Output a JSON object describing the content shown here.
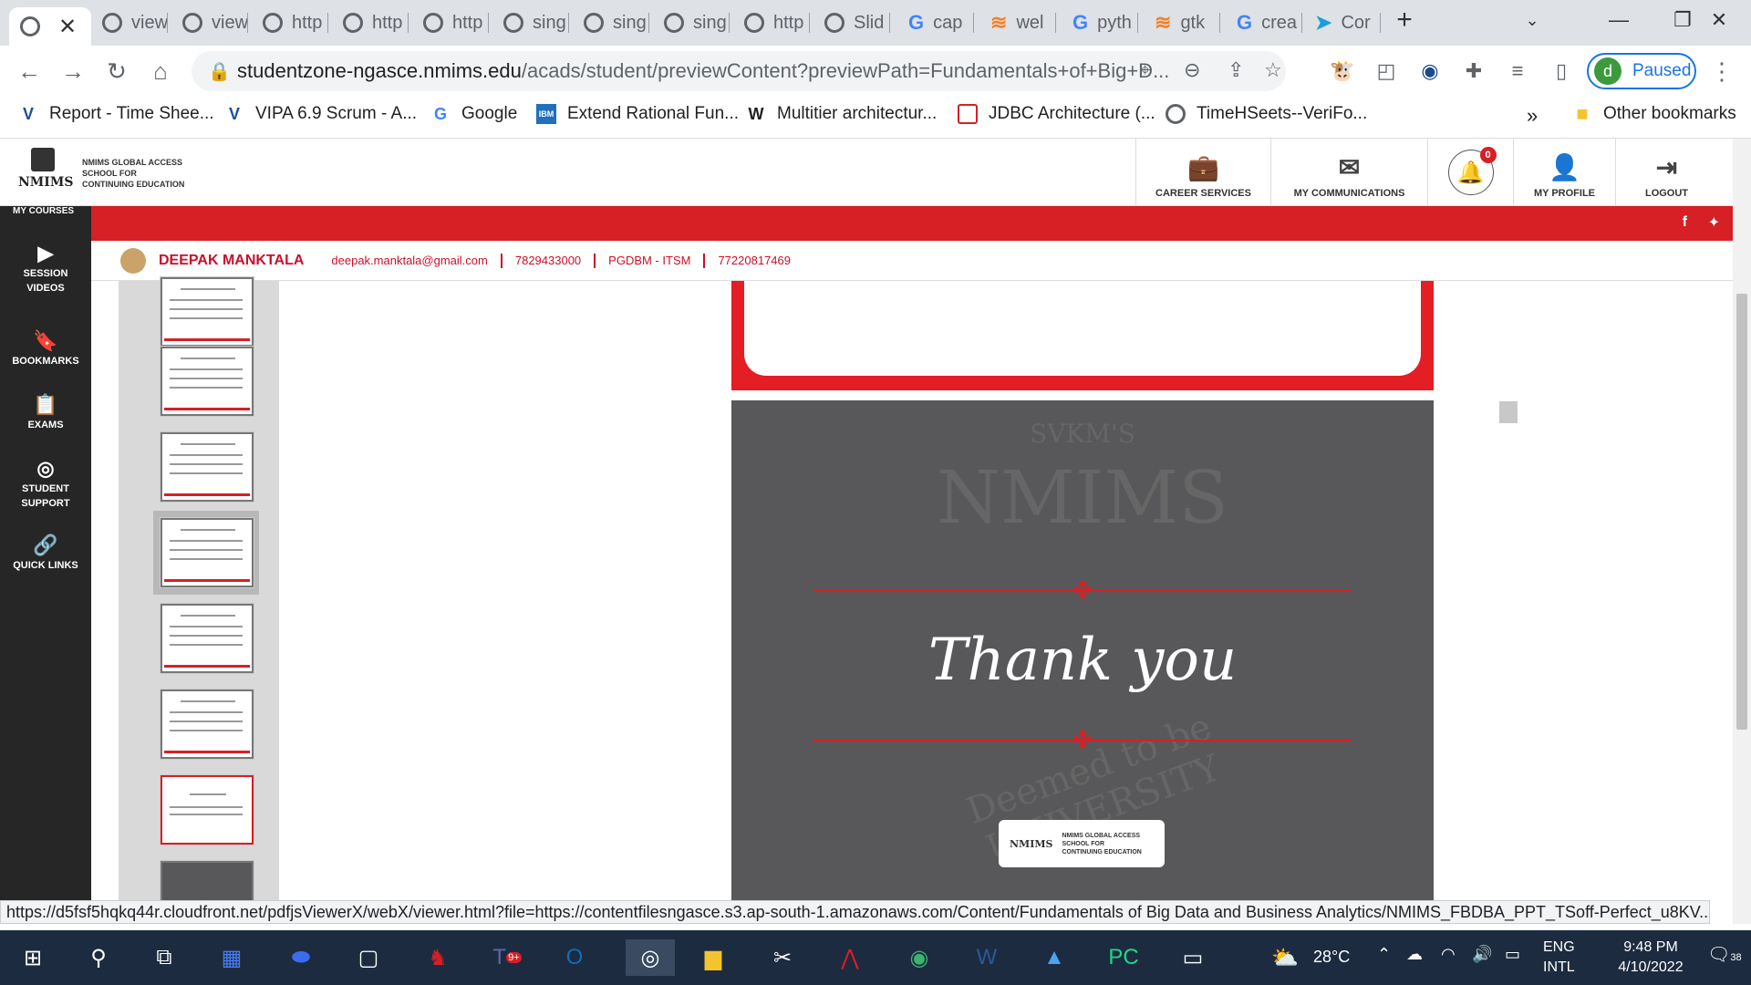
{
  "browser": {
    "tabs": [
      {
        "label": "",
        "icon": "globe-icon"
      },
      {
        "label": "view",
        "icon": "globe-icon"
      },
      {
        "label": "view",
        "icon": "globe-icon"
      },
      {
        "label": "http",
        "icon": "globe-icon"
      },
      {
        "label": "http",
        "icon": "globe-icon"
      },
      {
        "label": "http",
        "icon": "globe-icon"
      },
      {
        "label": "sing",
        "icon": "globe-icon"
      },
      {
        "label": "sing",
        "icon": "globe-icon"
      },
      {
        "label": "sing",
        "icon": "globe-icon"
      },
      {
        "label": "http",
        "icon": "globe-icon"
      },
      {
        "label": "Slid",
        "icon": "globe-icon"
      },
      {
        "label": "cap",
        "icon": "google-icon"
      },
      {
        "label": "wel",
        "icon": "stackoverflow-icon"
      },
      {
        "label": "pyth",
        "icon": "google-icon"
      },
      {
        "label": "gtk",
        "icon": "stackoverflow-icon"
      },
      {
        "label": "crea",
        "icon": "google-icon"
      },
      {
        "label": "Cor",
        "icon": "fish-icon"
      }
    ],
    "url_host": "studentzone-ngasce.nmims.edu",
    "url_path": "/acads/student/previewContent?previewPath=Fundamentals+of+Big+D...",
    "profile_initial": "d",
    "profile_label": "Paused",
    "bookmarks": [
      {
        "label": "Report - Time Shee..."
      },
      {
        "label": "VIPA 6.9 Scrum - A..."
      },
      {
        "label": "Google"
      },
      {
        "label": "Extend Rational Fun..."
      },
      {
        "label": "Multitier architectur..."
      },
      {
        "label": "JDBC Architecture (..."
      },
      {
        "label": "TimeHSeets--VeriFo..."
      }
    ],
    "overflow": "»",
    "other_bookmarks": "Other bookmarks",
    "status_url": "https://d5fsf5hqkq44r.cloudfront.net/pdfjsViewerX/webX/viewer.html?file=https://contentfilesngasce.s3.ap-south-1.amazonaws.com/Content/Fundamentals of Big Data and Business Analytics/NMIMS_FBDBA_PPT_TSoff-Perfect_u8KV..."
  },
  "site": {
    "logo_short": "NMIMS",
    "logo_line1": "NMIMS GLOBAL ACCESS",
    "logo_line2": "SCHOOL FOR",
    "logo_line3": "CONTINUING EDUCATION",
    "nav": {
      "career": "CAREER SERVICES",
      "communications": "MY COMMUNICATIONS",
      "notifications_count": "0",
      "profile": "MY PROFILE",
      "logout": "LOGOUT"
    },
    "my_courses": "MY COURSES",
    "user": {
      "name": "DEEPAK MANKTALA",
      "email": "deepak.manktala@gmail.com",
      "phone": "7829433000",
      "program": "PGDBM - ITSM",
      "id": "77220817469"
    },
    "sidebar": [
      {
        "label1": "SESSION",
        "label2": "VIDEOS"
      },
      {
        "label1": "BOOKMARKS",
        "label2": ""
      },
      {
        "label1": "EXAMS",
        "label2": ""
      },
      {
        "label1": "STUDENT",
        "label2": "SUPPORT"
      },
      {
        "label1": "QUICK LINKS",
        "label2": ""
      }
    ]
  },
  "slide": {
    "thank_you": "Thank you",
    "watermark": "NMIMS",
    "watermark_top": "SVKM'S",
    "watermark_arc": "Deemed to be UNIVERSITY",
    "logo_short": "NMIMS",
    "logo_line1": "NMIMS GLOBAL ACCESS",
    "logo_line2": "SCHOOL FOR",
    "logo_line3": "CONTINUING EDUCATION"
  },
  "taskbar": {
    "temperature": "28°C",
    "lang1": "ENG",
    "lang2": "INTL",
    "time": "9:48 PM",
    "date": "4/10/2022",
    "notif_count": "38",
    "teams_badge": "9+"
  }
}
